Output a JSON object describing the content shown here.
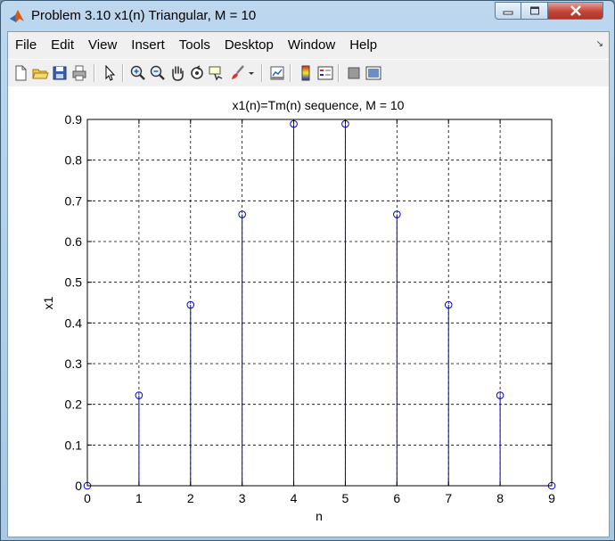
{
  "window": {
    "title": "Problem 3.10 x1(n) Triangular, M = 10"
  },
  "menu": {
    "items": [
      "File",
      "Edit",
      "View",
      "Insert",
      "Tools",
      "Desktop",
      "Window",
      "Help"
    ]
  },
  "toolbar": {
    "icons": [
      "new-figure-icon",
      "open-file-icon",
      "save-figure-icon",
      "print-figure-icon",
      "edit-plot-arrow-icon",
      "zoom-in-icon",
      "zoom-out-icon",
      "pan-hand-icon",
      "rotate-3d-icon",
      "data-cursor-icon",
      "brush-icon",
      "brush-dropdown-icon",
      "link-plot-icon",
      "insert-colorbar-icon",
      "insert-legend-icon",
      "hide-plot-tools-icon",
      "show-plot-tools-icon"
    ]
  },
  "colors": {
    "stem": "#0000c8",
    "axes": "#000000",
    "grid": "#000000"
  },
  "chart_data": {
    "type": "stem",
    "title": "x1(n)=Tm(n) sequence, M = 10",
    "xlabel": "n",
    "ylabel": "x1",
    "x": [
      0,
      1,
      2,
      3,
      4,
      5,
      6,
      7,
      8,
      9
    ],
    "y": [
      0,
      0.2222,
      0.4444,
      0.6667,
      0.8889,
      0.8889,
      0.6667,
      0.4444,
      0.2222,
      0
    ],
    "xlim": [
      0,
      9
    ],
    "ylim": [
      0,
      0.9
    ],
    "xticks": [
      "0",
      "1",
      "2",
      "3",
      "4",
      "5",
      "6",
      "7",
      "8",
      "9"
    ],
    "yticks": [
      "0",
      "0.1",
      "0.2",
      "0.3",
      "0.4",
      "0.5",
      "0.6",
      "0.7",
      "0.8",
      "0.9"
    ],
    "grid": true,
    "marker": "circle"
  }
}
